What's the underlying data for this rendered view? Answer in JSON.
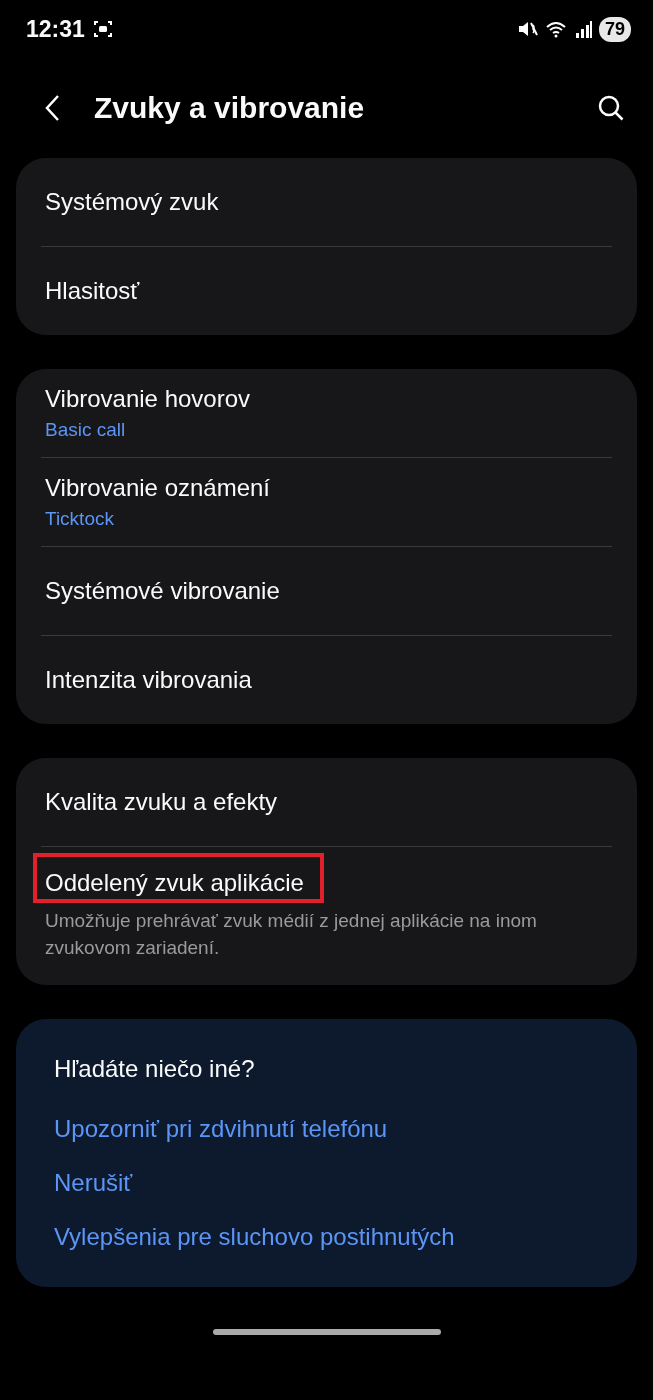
{
  "status_bar": {
    "time": "12:31",
    "battery": "79"
  },
  "header": {
    "title": "Zvuky a vibrovanie"
  },
  "groups": [
    {
      "items": [
        {
          "title": "Systémový zvuk",
          "highlighted": false
        },
        {
          "title": "Hlasitosť",
          "highlighted": false
        }
      ]
    },
    {
      "items": [
        {
          "title": "Vibrovanie hovorov",
          "value": "Basic call",
          "highlighted": false
        },
        {
          "title": "Vibrovanie oznámení",
          "value": "Ticktock",
          "highlighted": false
        },
        {
          "title": "Systémové vibrovanie",
          "highlighted": false
        },
        {
          "title": "Intenzita vibrovania",
          "highlighted": false
        }
      ]
    },
    {
      "items": [
        {
          "title": "Kvalita zvuku a efekty",
          "highlighted": false
        },
        {
          "title": "Oddelený zvuk aplikácie",
          "description": "Umožňuje prehrávať zvuk médií z jednej aplikácie na inom zvukovom zariadení.",
          "highlighted": true
        }
      ]
    }
  ],
  "suggestions": {
    "title": "Hľadáte niečo iné?",
    "links": [
      "Upozorniť pri zdvihnutí telefónu",
      "Nerušiť",
      "Vylepšenia pre sluchovo postihnutých"
    ]
  }
}
